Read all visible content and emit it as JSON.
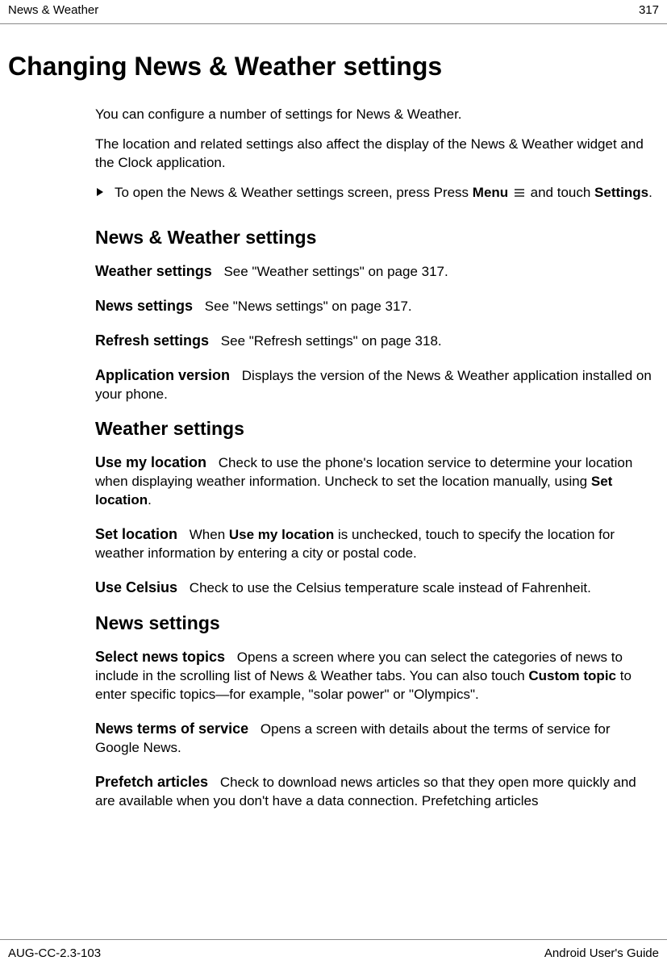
{
  "header": {
    "section": "News & Weather",
    "page_number": "317"
  },
  "title": "Changing News & Weather settings",
  "intro": {
    "p1": "You can configure a number of settings for News & Weather.",
    "p2": "The location and related settings also affect the display of the News & Weather widget and the Clock application."
  },
  "step": {
    "pre": "To open the News & Weather settings screen, press Press ",
    "menu_word": "Menu",
    "mid": " and touch ",
    "settings_word": "Settings",
    "post": "."
  },
  "sections": {
    "nw_settings": {
      "heading": "News & Weather settings",
      "items": [
        {
          "title": "Weather settings",
          "desc": "See \"Weather settings\" on page 317."
        },
        {
          "title": "News settings",
          "desc": "See \"News settings\" on page 317."
        },
        {
          "title": "Refresh settings",
          "desc": "See \"Refresh settings\" on page 318."
        },
        {
          "title": "Application version",
          "desc": "Displays the version of the News & Weather application installed on your phone."
        }
      ]
    },
    "weather_settings": {
      "heading": "Weather settings",
      "use_my_location": {
        "title": "Use my location",
        "pre": "Check to use the phone's location service to determine your location when displaying weather information. Uncheck to set the location manually, using ",
        "bold": "Set location",
        "post": "."
      },
      "set_location": {
        "title": "Set location",
        "pre": "When ",
        "bold": "Use my location",
        "post": " is unchecked, touch to specify the location for weather information by entering a city or postal code."
      },
      "use_celsius": {
        "title": "Use Celsius",
        "desc": "Check to use the Celsius temperature scale instead of Fahrenheit."
      }
    },
    "news_settings": {
      "heading": "News settings",
      "select_topics": {
        "title": "Select news topics",
        "pre": "Opens a screen where you can select the categories of news to include in the scrolling list of News & Weather tabs. You can also touch ",
        "bold": "Custom topic",
        "post": " to enter specific topics—for example, \"solar power\" or \"Olympics\"."
      },
      "terms": {
        "title": "News terms of service",
        "desc": "Opens a screen with details about the terms of service for Google News."
      },
      "prefetch": {
        "title": "Prefetch articles",
        "desc": "Check to download news articles so that they open more quickly and are available when you don't have a data connection. Prefetching articles"
      }
    }
  },
  "footer": {
    "doc_id": "AUG-CC-2.3-103",
    "guide_name": "Android User's Guide"
  }
}
